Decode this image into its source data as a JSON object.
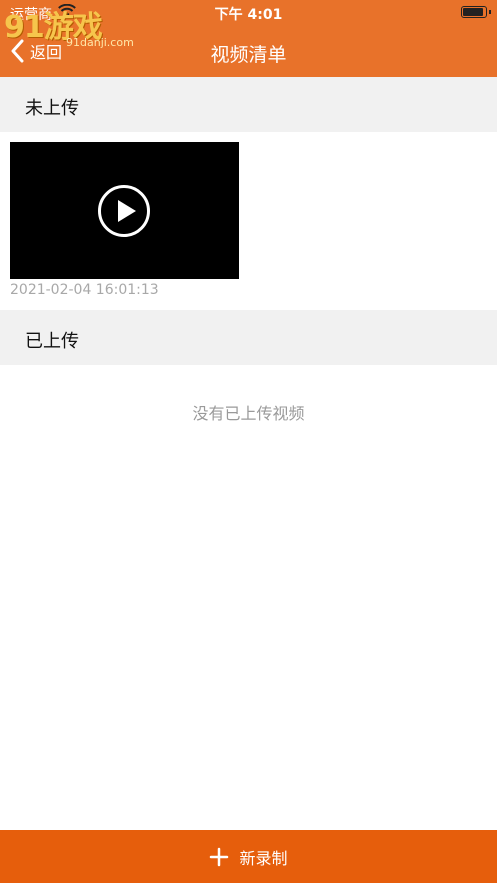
{
  "status_bar": {
    "carrier": "运营商",
    "time": "下午 4:01"
  },
  "watermark": {
    "text": "91游戏",
    "sub": "91danji.com"
  },
  "nav": {
    "back_label": "返回",
    "title": "视频清单"
  },
  "sections": {
    "not_uploaded": {
      "title": "未上传",
      "videos": [
        {
          "timestamp": "2021-02-04 16:01:13"
        }
      ]
    },
    "uploaded": {
      "title": "已上传",
      "empty_text": "没有已上传视频"
    }
  },
  "bottom": {
    "record_label": "新录制"
  },
  "colors": {
    "header": "#e8722a",
    "bottom_button": "#e65e0c",
    "section_bg": "#f1f1f1"
  }
}
